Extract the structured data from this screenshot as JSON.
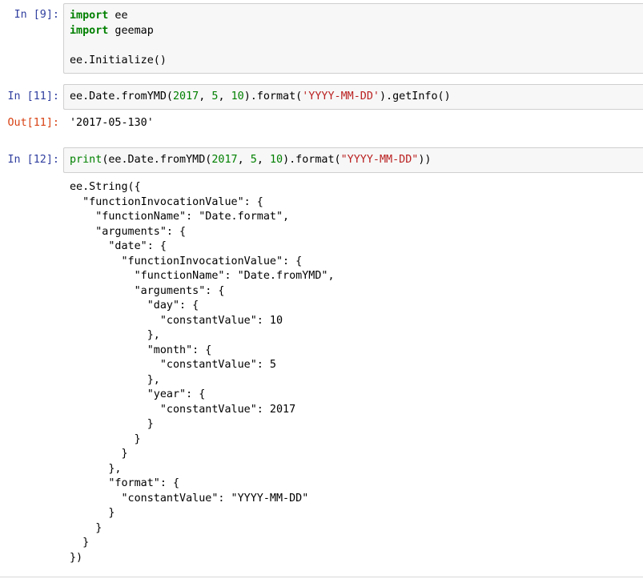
{
  "cells": [
    {
      "prompt": "In [9]:",
      "lines": [
        [
          {
            "t": "import",
            "c": "kw"
          },
          {
            "t": " ee"
          }
        ],
        [
          {
            "t": "import",
            "c": "kw"
          },
          {
            "t": " geemap"
          }
        ],
        [
          {
            "t": ""
          }
        ],
        [
          {
            "t": "ee.Initialize()"
          }
        ]
      ]
    },
    {
      "prompt": "In [11]:",
      "lines": [
        [
          {
            "t": "ee.Date.fromYMD("
          },
          {
            "t": "2017",
            "c": "num"
          },
          {
            "t": ", "
          },
          {
            "t": "5",
            "c": "num"
          },
          {
            "t": ", "
          },
          {
            "t": "10",
            "c": "num"
          },
          {
            "t": ").format("
          },
          {
            "t": "'YYYY-MM-DD'",
            "c": "str"
          },
          {
            "t": ").getInfo()"
          }
        ]
      ],
      "out_prompt": "Out[11]:",
      "output": "'2017-05-130'"
    },
    {
      "prompt": "In [12]:",
      "lines": [
        [
          {
            "t": "print",
            "c": "bi"
          },
          {
            "t": "(ee.Date.fromYMD("
          },
          {
            "t": "2017",
            "c": "num"
          },
          {
            "t": ", "
          },
          {
            "t": "5",
            "c": "num"
          },
          {
            "t": ", "
          },
          {
            "t": "10",
            "c": "num"
          },
          {
            "t": ").format("
          },
          {
            "t": "\"YYYY-MM-DD\"",
            "c": "str"
          },
          {
            "t": "))"
          }
        ]
      ],
      "stdout": [
        "ee.String({",
        "  \"functionInvocationValue\": {",
        "    \"functionName\": \"Date.format\",",
        "    \"arguments\": {",
        "      \"date\": {",
        "        \"functionInvocationValue\": {",
        "          \"functionName\": \"Date.fromYMD\",",
        "          \"arguments\": {",
        "            \"day\": {",
        "              \"constantValue\": 10",
        "            },",
        "            \"month\": {",
        "              \"constantValue\": 5",
        "            },",
        "            \"year\": {",
        "              \"constantValue\": 2017",
        "            }",
        "          }",
        "        }",
        "      },",
        "      \"format\": {",
        "        \"constantValue\": \"YYYY-MM-DD\"",
        "      }",
        "    }",
        "  }",
        "})"
      ]
    }
  ]
}
